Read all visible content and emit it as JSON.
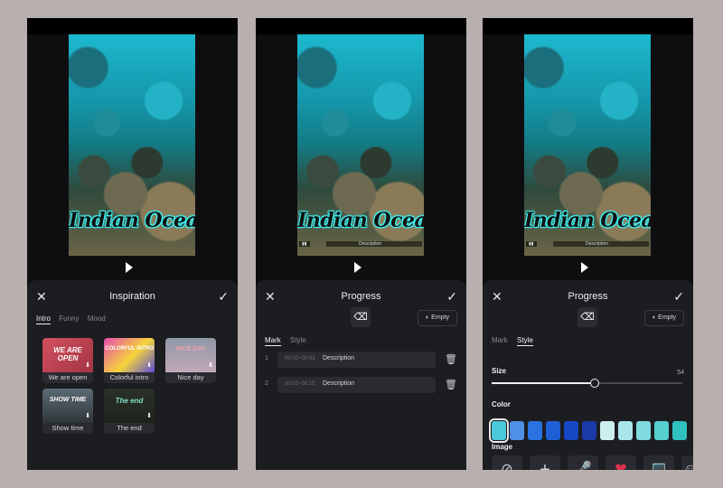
{
  "video": {
    "overlay_title": "Indian Ocean"
  },
  "screen1": {
    "title": "Inspiration",
    "tabs": [
      "Intro",
      "Funny",
      "Mood"
    ],
    "active_tab": "Intro",
    "templates": [
      {
        "caption": "We are open",
        "thumb_text": "WE ARE OPEN",
        "color": "#c4485a"
      },
      {
        "caption": "Colorful intro",
        "thumb_text": "COLORFUL INTRO",
        "color": "#e64bb0"
      },
      {
        "caption": "Nice day",
        "thumb_text": "NICE DAY",
        "color": "#9aa2b0"
      },
      {
        "caption": "Show time",
        "thumb_text": "SHOW TIME",
        "color": "#3c4a52"
      },
      {
        "caption": "The end",
        "thumb_text": "The end",
        "color": "#2e3428"
      }
    ]
  },
  "screen2": {
    "title": "Progress",
    "empty_label": "Empty",
    "tabs": [
      "Mark",
      "Style"
    ],
    "active_tab": "Mark",
    "marks": [
      {
        "num": "1",
        "time": "00:00~00:03",
        "desc": "Description"
      },
      {
        "num": "2",
        "time": "00:03~00:15",
        "desc": "Description"
      }
    ]
  },
  "screen3": {
    "title": "Progress",
    "empty_label": "Empty",
    "tabs": [
      "Mark",
      "Style"
    ],
    "active_tab": "Style",
    "size_label": "Size",
    "size_value": "54",
    "size_fraction": 0.54,
    "color_label": "Color",
    "colors": [
      "#4cc9d8",
      "#4f8fe6",
      "#2a72e0",
      "#1f5fd6",
      "#1847c4",
      "#1a3aa8",
      "#cdeff0",
      "#a9e6ea",
      "#7fdbe0",
      "#55cfcf",
      "#2fc0c0"
    ],
    "selected_color_index": 0,
    "image_label": "Image"
  },
  "icons": {
    "close": "close-icon",
    "confirm": "check-icon",
    "play": "play-icon",
    "erase": "eraser-icon",
    "trash": "trash-icon",
    "download": "download-icon",
    "none": "no-image-icon",
    "add": "plus-icon"
  }
}
